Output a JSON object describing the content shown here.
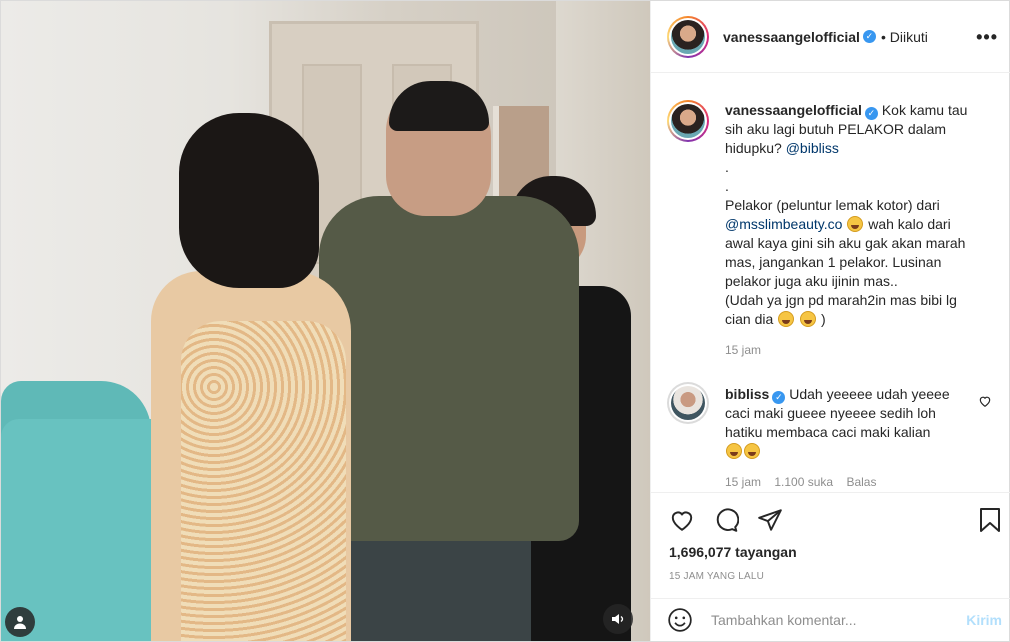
{
  "post": {
    "author": "vanessaangelofficial",
    "follow_status": "• Diikuti",
    "more_icon": "more-options-icon"
  },
  "caption": {
    "username": "vanessaangelofficial",
    "lines": [
      "Kok kamu tau",
      "sih aku lagi butuh PELAKOR dalam",
      "hidupku?",
      ".",
      ".",
      "Pelakor (peluntur lemak kotor) dari",
      "wah kalo dari",
      "awal kaya gini sih aku gak akan marah",
      "mas, jangankan 1 pelakor. Lusinan",
      "pelakor juga aku ijinin mas..",
      "(Udah ya jgn pd marah2in mas bibi lg",
      "cian dia",
      ")"
    ],
    "mention_1": "@bibliss",
    "mention_2": "@msslimbeauty.co",
    "time": "15 jam"
  },
  "reply": {
    "username": "bibliss",
    "lines": [
      "Udah yeeeee udah yeeee",
      "caci maki gueee nyeeee sedih loh",
      "hatiku membaca caci maki kalian"
    ],
    "time": "15 jam",
    "likes": "1.100 suka",
    "reply_label": "Balas"
  },
  "stats": {
    "views": "1,696,077 tayangan",
    "time_ago": "15 JAM YANG LALU"
  },
  "add_comment": {
    "placeholder": "Tambahkan komentar...",
    "post_label": "Kirim"
  },
  "colors": {
    "verified": "#3897f0",
    "mention": "#00376b",
    "muted": "#8e8e8e",
    "post_disabled": "#b2dffc"
  }
}
